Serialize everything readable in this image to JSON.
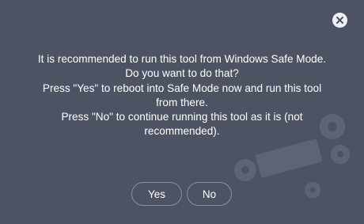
{
  "dialog": {
    "message_lines": [
      "It is recommended to run this tool from Windows Safe Mode.",
      "Do you want to do that?",
      "Press \"Yes\" to reboot into Safe Mode now and run this tool",
      "from there.",
      "Press \"No\" to continue running this tool as it is (not",
      "recommended)."
    ],
    "yes_label": "Yes",
    "no_label": "No",
    "close_icon": "close-icon"
  },
  "colors": {
    "background": "#4d5363",
    "text": "#ffffff",
    "button_border": "#8a909c",
    "close_bg": "#eef0f3"
  }
}
